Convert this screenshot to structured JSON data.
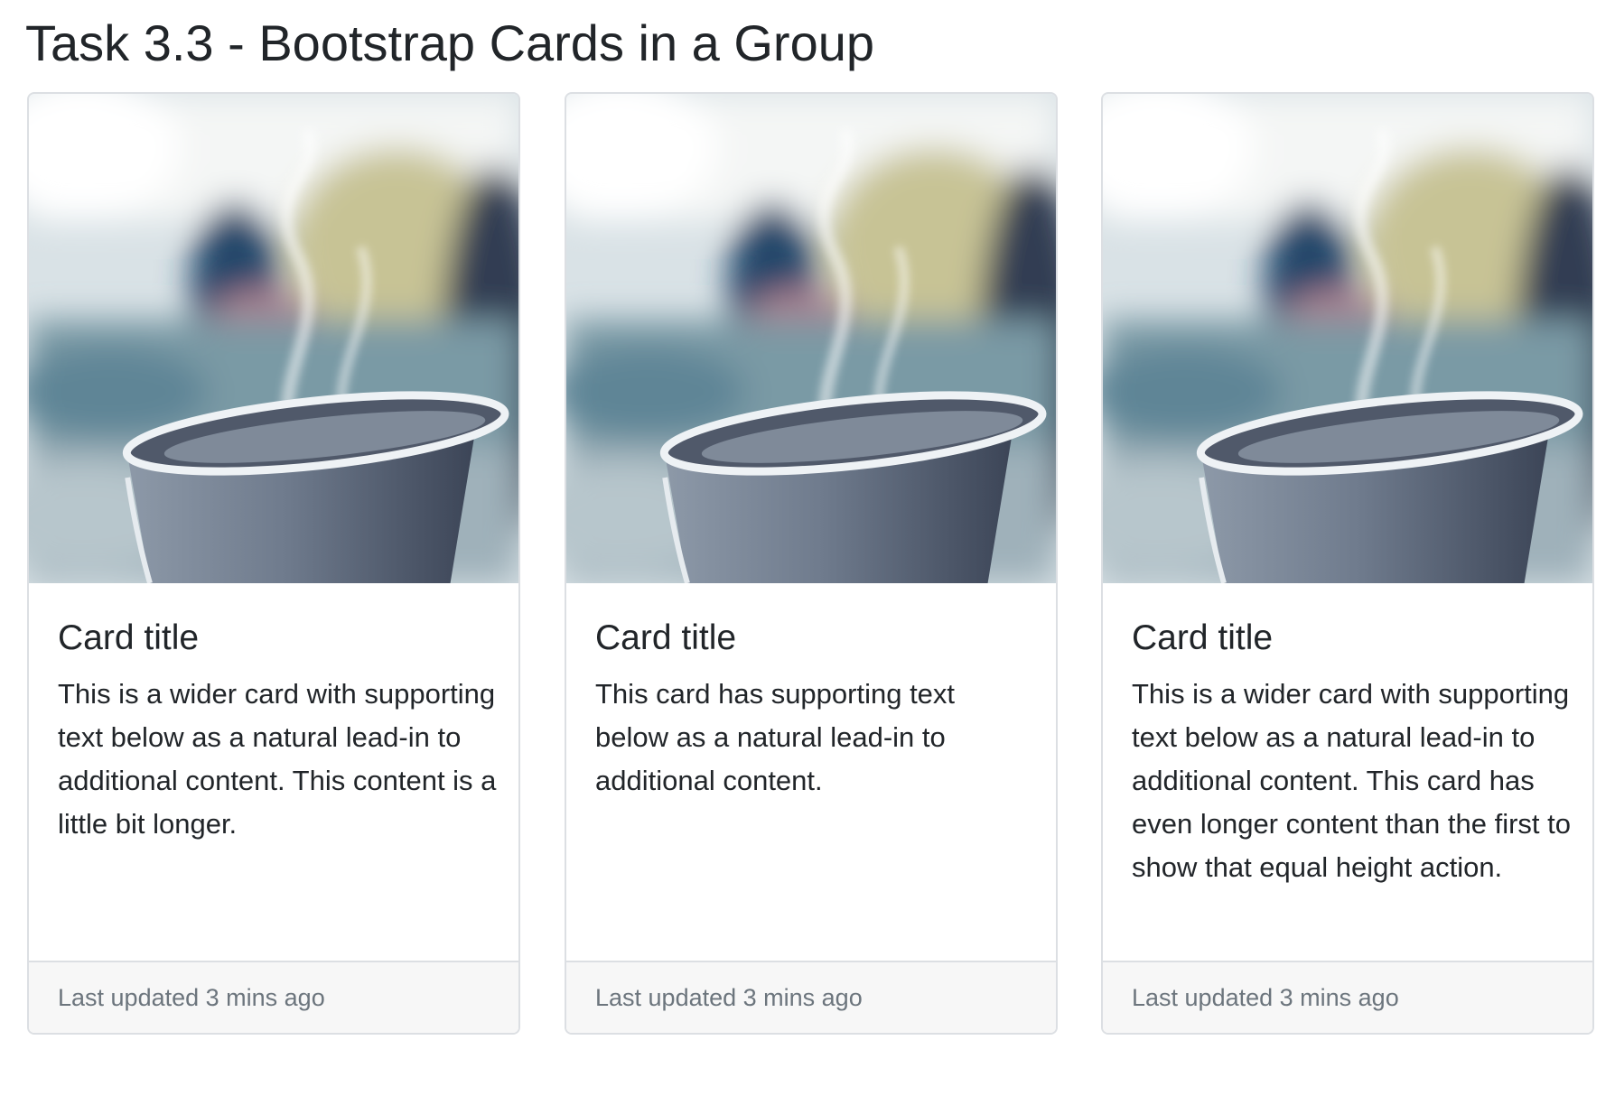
{
  "page": {
    "title": "Task 3.3 - Bootstrap Cards in a Group"
  },
  "cards": [
    {
      "image_alt": "steaming-cup-photo",
      "title": "Card title",
      "text": "This is a wider card with supporting text below as a natural lead-in to additional content. This content is a little bit longer.",
      "footer": "Last updated 3 mins ago"
    },
    {
      "image_alt": "steaming-cup-photo",
      "title": "Card title",
      "text": "This card has supporting text below as a natural lead-in to additional content.",
      "footer": "Last updated 3 mins ago"
    },
    {
      "image_alt": "steaming-cup-photo",
      "title": "Card title",
      "text": "This is a wider card with supporting text below as a natural lead-in to additional content. This card has even longer content than the first to show that equal height action.",
      "footer": "Last updated 3 mins ago"
    }
  ],
  "colors": {
    "text": "#212529",
    "muted": "#6c757d",
    "border": "#dcdfe3",
    "footer_bg": "#f7f7f7"
  }
}
